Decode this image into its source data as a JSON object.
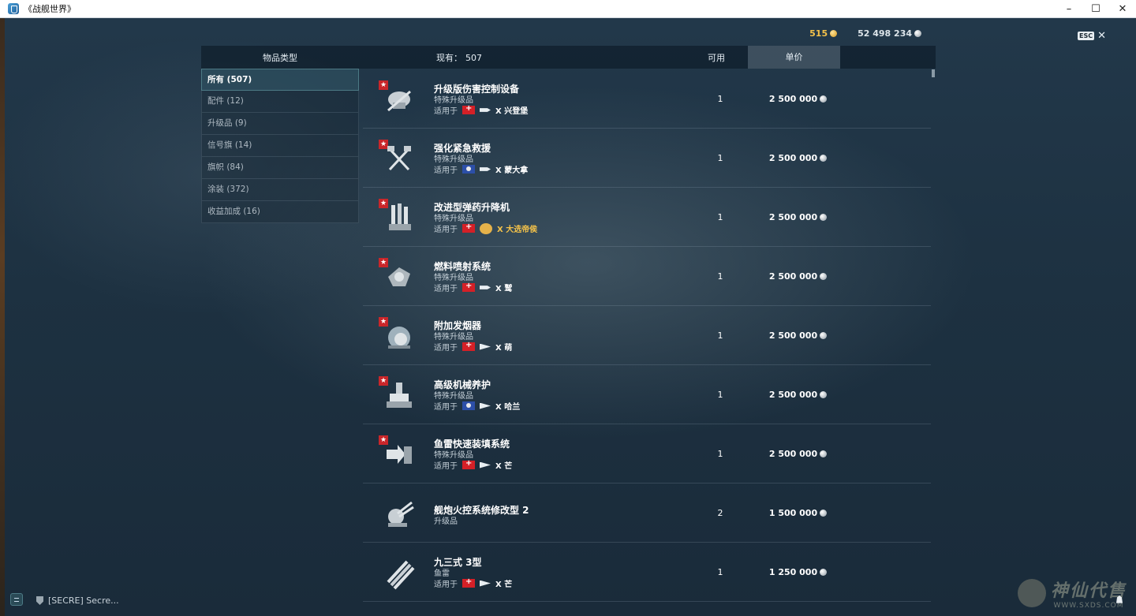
{
  "window": {
    "title": "《战舰世界》",
    "minimize": "–",
    "maximize": "☐",
    "close": "✕"
  },
  "currency": {
    "doubloons": "515",
    "credits": "52 498 234"
  },
  "esc": {
    "key": "ESC",
    "close": "✕"
  },
  "header": {
    "category": "物品类型",
    "count_label": "现有：",
    "count_value": "507",
    "available": "可用",
    "price": "单价"
  },
  "sidebar": {
    "items": [
      {
        "label": "所有 (507)"
      },
      {
        "label": "配件 (12)"
      },
      {
        "label": "升级品 (9)"
      },
      {
        "label": "信号旗 (14)"
      },
      {
        "label": "旗帜 (84)"
      },
      {
        "label": "涂装 (372)"
      },
      {
        "label": "收益加成 (16)"
      }
    ]
  },
  "items": [
    {
      "name": "升级版伤害控制设备",
      "type": "特殊升级品",
      "applies": "适用于",
      "ship": "X 兴登堡",
      "available": "1",
      "price": "2 500 000",
      "icon": "damage-control-icon"
    },
    {
      "name": "强化紧急救援",
      "type": "特殊升级品",
      "applies": "适用于",
      "ship": "X 蒙大拿",
      "available": "1",
      "price": "2 500 000",
      "icon": "emergency-repair-icon"
    },
    {
      "name": "改进型弹药升降机",
      "type": "特殊升级品",
      "applies": "适用于",
      "ship": "X 大选帝侯",
      "available": "1",
      "price": "2 500 000",
      "icon": "ammo-hoist-icon"
    },
    {
      "name": "燃料喷射系统",
      "type": "特殊升级品",
      "applies": "适用于",
      "ship": "X 鹫",
      "available": "1",
      "price": "2 500 000",
      "icon": "fuel-injection-icon"
    },
    {
      "name": "附加发烟器",
      "type": "特殊升级品",
      "applies": "适用于",
      "ship": "X 萌",
      "available": "1",
      "price": "2 500 000",
      "icon": "smoke-generator-icon"
    },
    {
      "name": "高级机械养护",
      "type": "特殊升级品",
      "applies": "适用于",
      "ship": "X 哈兰",
      "available": "1",
      "price": "2 500 000",
      "icon": "engine-maintenance-icon"
    },
    {
      "name": "鱼雷快速装填系统",
      "type": "特殊升级品",
      "applies": "适用于",
      "ship": "X 芒",
      "available": "1",
      "price": "2 500 000",
      "icon": "torpedo-reload-icon"
    },
    {
      "name": "舰炮火控系统修改型 2",
      "type": "升级品",
      "applies": "",
      "ship": "",
      "available": "2",
      "price": "1 500 000",
      "icon": "fire-control-icon"
    },
    {
      "name": "九三式 3型",
      "type": "鱼雷",
      "applies": "适用于",
      "ship": "X 芒",
      "available": "1",
      "price": "1 250 000",
      "icon": "torpedo-icon"
    }
  ],
  "bottom": {
    "clan": "[SECRE]  Secre..."
  },
  "watermark": {
    "main": "神仙代售",
    "url": "WWW.SXDS.COM"
  }
}
